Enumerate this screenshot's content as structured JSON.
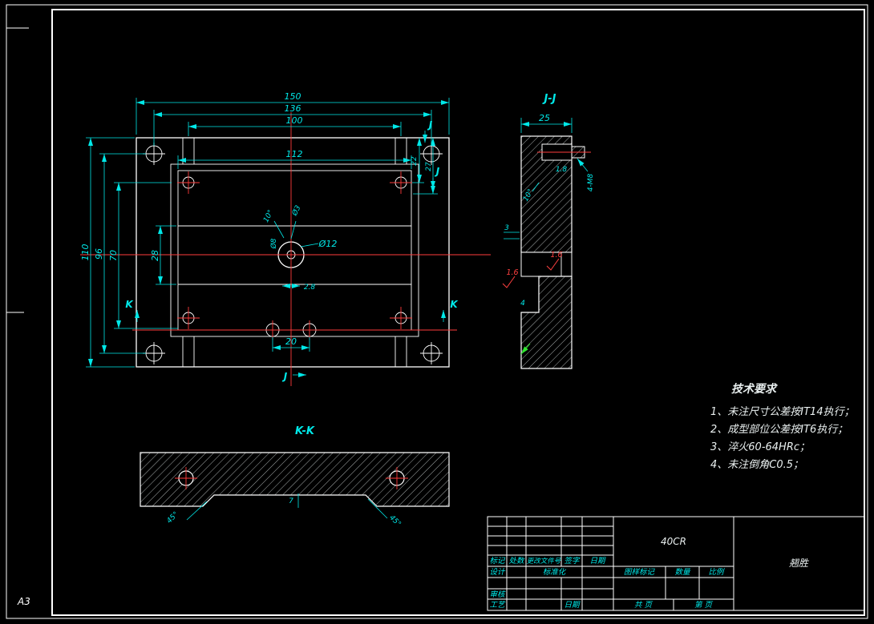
{
  "sheet": {
    "size_label": "A3"
  },
  "main_view": {
    "dim_150": "150",
    "dim_136": "136",
    "dim_100": "100",
    "dim_112": "112",
    "dim_110": "110",
    "dim_96": "96",
    "dim_70": "70",
    "dim_28": "28",
    "dim_22": "22",
    "dim_27": "27",
    "dim_20": "20",
    "dim_2_8": "2.8",
    "dim_d12": "Ø12",
    "dim_d8": "Ø8",
    "dim_taper": "10°",
    "dim_d3": "Ø3",
    "label_j_top": "J",
    "label_j_mid": "J",
    "label_j_bottom": "J",
    "label_k_left": "K",
    "label_k_right": "K"
  },
  "section_jj": {
    "title": "J-J",
    "dim_25": "25",
    "dim_4m8": "4-M8",
    "dim_1_8": "1.8",
    "dim_3": "3",
    "dim_10deg": "10°",
    "rough_a": "1.6",
    "rough_b": "1.6",
    "dim_4": "4"
  },
  "section_kk": {
    "title": "K-K",
    "dim_45_left": "45°",
    "dim_45_right": "45°",
    "dim_7": "7"
  },
  "tech_requirements": {
    "title": "技术要求",
    "items": [
      "1、未注尺寸公差按IT14执行；",
      "2、成型部位公差按IT6执行；",
      "3、淬火60-64HRc；",
      "4、未注倒角C0.5；"
    ]
  },
  "title_block": {
    "material": "40CR",
    "part_name": "翘胜",
    "col_mark": "标记",
    "col_count": "处数",
    "col_change_doc": "更改文件号",
    "col_sign": "签字",
    "col_date": "日期",
    "row_design": "设计",
    "row_standardize": "标准化",
    "row_check": "审核",
    "row_process": "工艺",
    "row_date": "日期",
    "cell_drawing_mark": "图样标记",
    "cell_qty": "数量",
    "cell_scale": "比例",
    "cell_total": "共  页",
    "cell_page": "第  页"
  }
}
